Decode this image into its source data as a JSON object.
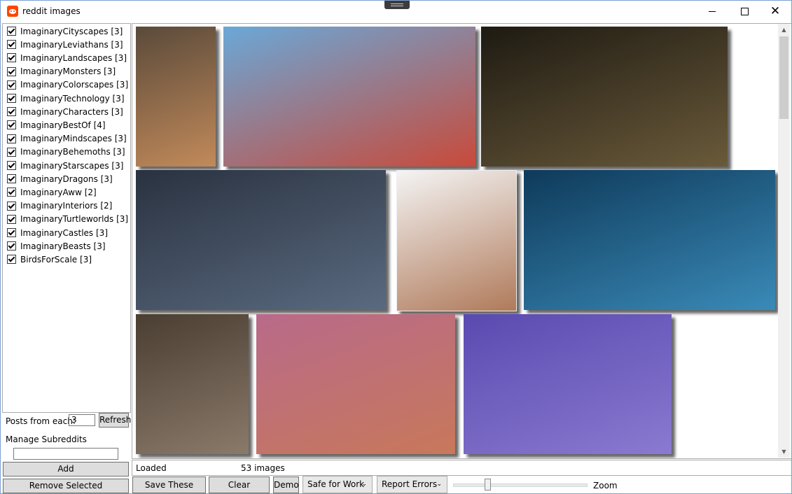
{
  "window": {
    "title": "reddit images",
    "minimize_icon": "minimize-icon",
    "maximize_icon": "maximize-icon",
    "close_icon": "close-icon",
    "close_glyph": "✕"
  },
  "sidebar": {
    "subreddits": [
      {
        "label": "ImaginaryCityscapes [3]",
        "checked": true
      },
      {
        "label": "ImaginaryLeviathans [3]",
        "checked": true
      },
      {
        "label": "ImaginaryLandscapes [3]",
        "checked": true
      },
      {
        "label": "ImaginaryMonsters [3]",
        "checked": true
      },
      {
        "label": "ImaginaryColorscapes [3]",
        "checked": true
      },
      {
        "label": "ImaginaryTechnology [3]",
        "checked": true
      },
      {
        "label": "ImaginaryCharacters [3]",
        "checked": true
      },
      {
        "label": "ImaginaryBestOf [4]",
        "checked": true
      },
      {
        "label": "ImaginaryMindscapes [3]",
        "checked": true
      },
      {
        "label": "ImaginaryBehemoths [3]",
        "checked": true
      },
      {
        "label": "ImaginaryStarscapes [3]",
        "checked": true
      },
      {
        "label": "ImaginaryDragons [3]",
        "checked": true
      },
      {
        "label": "ImaginaryAww [2]",
        "checked": true
      },
      {
        "label": "ImaginaryInteriors [2]",
        "checked": true
      },
      {
        "label": "ImaginaryTurtleworlds [3]",
        "checked": true
      },
      {
        "label": "ImaginaryCastles [3]",
        "checked": true
      },
      {
        "label": "ImaginaryBeasts [3]",
        "checked": true
      },
      {
        "label": "BirdsForScale [3]",
        "checked": true
      }
    ],
    "posts_label": "Posts from each:",
    "posts_value": "3",
    "refresh_label": "Refresh",
    "manage_label": "Manage Subreddits",
    "manage_input_value": "",
    "add_label": "Add",
    "remove_label": "Remove Selected"
  },
  "gallery": {
    "images": [
      {
        "name": "rainy-city-street-image",
        "colors": [
          "#5a4a3a",
          "#c28a5a"
        ]
      },
      {
        "name": "thai-street-tuk-tuk-image",
        "colors": [
          "#6aa8d8",
          "#c84a3a"
        ]
      },
      {
        "name": "dark-batman-city-image",
        "colors": [
          "#1e1a12",
          "#6a5a3a"
        ]
      },
      {
        "name": "dark-fantasy-landscape-image",
        "colors": [
          "#2a3240",
          "#5a6a80"
        ]
      },
      {
        "name": "crab-monster-island-image",
        "colors": [
          "#f4f4f4",
          "#b07a5a"
        ]
      },
      {
        "name": "underwater-whale-shark-image",
        "colors": [
          "#0e3a5a",
          "#3a8ab8"
        ]
      },
      {
        "name": "rocky-cliff-village-image",
        "colors": [
          "#4a3e32",
          "#8a7a6a"
        ]
      },
      {
        "name": "alien-rings-landscape-image",
        "colors": [
          "#b86a8a",
          "#c8785a"
        ]
      },
      {
        "name": "giant-robots-beach-image",
        "colors": [
          "#5a4ab0",
          "#8a7ad0"
        ]
      }
    ]
  },
  "status": {
    "text": "Loaded",
    "count": "53 images"
  },
  "toolbar": {
    "save_label": "Save These Images",
    "clear_label": "Clear Messages",
    "demo_label": "Demo",
    "sfw_value": "Safe for Work",
    "errors_value": "Report Errors",
    "dropdown_arrow": "⌄",
    "zoom_label": "Zoom",
    "zoom_level": 0.25
  },
  "scrollbar": {
    "up_arrow": "▲",
    "down_arrow": "▼"
  }
}
